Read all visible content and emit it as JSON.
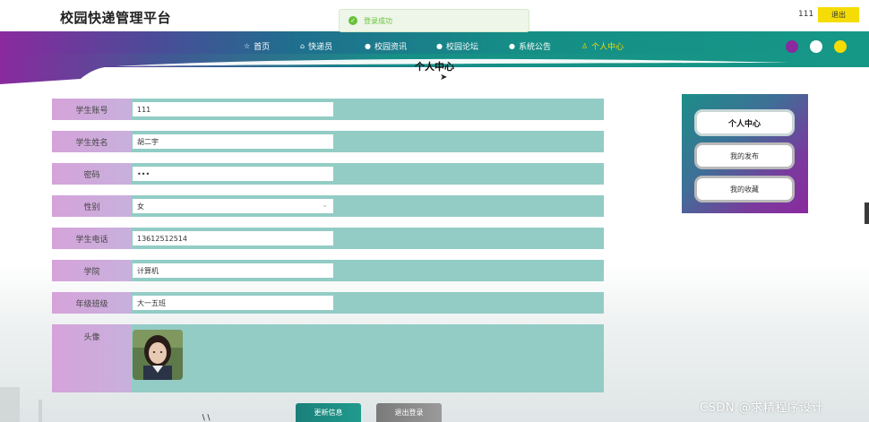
{
  "header": {
    "site_title": "校园快递管理平台",
    "user_name": "111",
    "logout_label": "退出"
  },
  "toast": {
    "icon": "check-circle-icon",
    "message": "登录成功",
    "color": "#67c23a"
  },
  "nav": {
    "items": [
      {
        "icon": "star-icon",
        "glyph": "☆",
        "label": "首页"
      },
      {
        "icon": "lock-icon",
        "glyph": "⌂",
        "label": "快递员"
      },
      {
        "icon": "info-icon",
        "glyph": "●",
        "label": "校园资讯"
      },
      {
        "icon": "info-icon",
        "glyph": "●",
        "label": "校园论坛"
      },
      {
        "icon": "info-icon",
        "glyph": "●",
        "label": "系统公告"
      },
      {
        "icon": "user-icon",
        "glyph": "♙",
        "label": "个人中心",
        "active": true
      }
    ],
    "theme_dots": [
      {
        "name": "theme-purple",
        "color": "#8a2a9e"
      },
      {
        "name": "theme-white",
        "color": "#ffffff"
      },
      {
        "name": "theme-yellow",
        "color": "#f5dc05"
      }
    ]
  },
  "page": {
    "heading": "个人中心"
  },
  "form": {
    "fields": [
      {
        "name": "student-account",
        "label": "学生账号",
        "value": "111"
      },
      {
        "name": "student-name",
        "label": "学生姓名",
        "value": "胡二宇"
      },
      {
        "name": "password",
        "label": "密码",
        "value": "•••"
      },
      {
        "name": "gender",
        "label": "性别",
        "value": "女",
        "type": "select"
      },
      {
        "name": "student-phone",
        "label": "学生电话",
        "value": "13612512514"
      },
      {
        "name": "college",
        "label": "学院",
        "value": "计算机"
      },
      {
        "name": "grade-class",
        "label": "年级班级",
        "value": "大一五班"
      }
    ],
    "avatar_label": "头像",
    "update_label": "更新信息",
    "logout_label": "退出登录"
  },
  "side_menu": {
    "items": [
      {
        "label": "个人中心",
        "primary": true
      },
      {
        "label": "我的发布"
      },
      {
        "label": "我的收藏"
      }
    ]
  },
  "watermark": "CSDN @求精程序设计",
  "colors": {
    "accent_teal": "#169887",
    "accent_purple": "#8a2a9e",
    "accent_yellow": "#f5dc05",
    "row_bg": "#92ccc5",
    "label_bg": "#d5a3da"
  }
}
